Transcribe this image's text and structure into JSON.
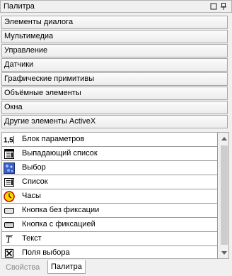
{
  "panel": {
    "title": "Палитра"
  },
  "categories": [
    "Элементы диалога",
    "Мультимедиа",
    "Управление",
    "Датчики",
    "Графические примитивы",
    "Объёмные элементы",
    "Окна",
    "Другие элементы ActiveX"
  ],
  "items": [
    {
      "label": "Блок параметров",
      "icon": "parameter-block-icon",
      "glyph": "1,5"
    },
    {
      "label": "Выпадающий список",
      "icon": "dropdown-list-icon"
    },
    {
      "label": "Выбор",
      "icon": "choice-icon"
    },
    {
      "label": "Список",
      "icon": "list-icon"
    },
    {
      "label": "Часы",
      "icon": "clock-icon"
    },
    {
      "label": "Кнопка без фиксации",
      "icon": "push-button-icon"
    },
    {
      "label": "Кнопка с фиксацией",
      "icon": "toggle-button-icon"
    },
    {
      "label": "Текст",
      "icon": "text-icon",
      "glyph": "T"
    },
    {
      "label": "Поля выбора",
      "icon": "checkbox-field-icon"
    }
  ],
  "tabs": {
    "properties": "Свойства",
    "palette": "Палитра"
  }
}
